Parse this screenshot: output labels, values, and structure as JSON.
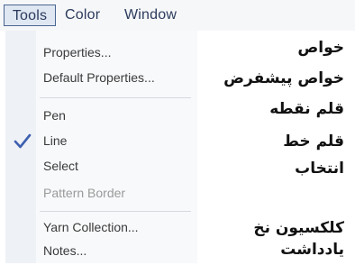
{
  "menubar": {
    "items": [
      "Tools",
      "Color",
      "Window"
    ],
    "active": "Tools"
  },
  "menu": {
    "items": [
      {
        "label": "Properties...",
        "enabled": true
      },
      {
        "label": "Default Properties...",
        "enabled": true
      },
      {
        "label": "Pen",
        "enabled": true
      },
      {
        "label": "Line",
        "enabled": true,
        "checked": true
      },
      {
        "label": "Select",
        "enabled": true
      },
      {
        "label": "Pattern Border",
        "enabled": false
      },
      {
        "label": "Yarn Collection...",
        "enabled": true
      },
      {
        "label": "Notes...",
        "enabled": true
      }
    ],
    "check_icon": "checkmark-icon"
  },
  "translations": [
    "خواص",
    "خواص پیشفرض",
    "قلم نقطه",
    "قلم خط",
    "انتخاب",
    "كلكسیون نخ",
    "یادداشت"
  ],
  "colors": {
    "menubar_active_border": "#4a6691",
    "menubar_active_bg": "#dfe7f2",
    "checkmark": "#3d5fb0",
    "disabled_text": "#9a9a9a"
  }
}
